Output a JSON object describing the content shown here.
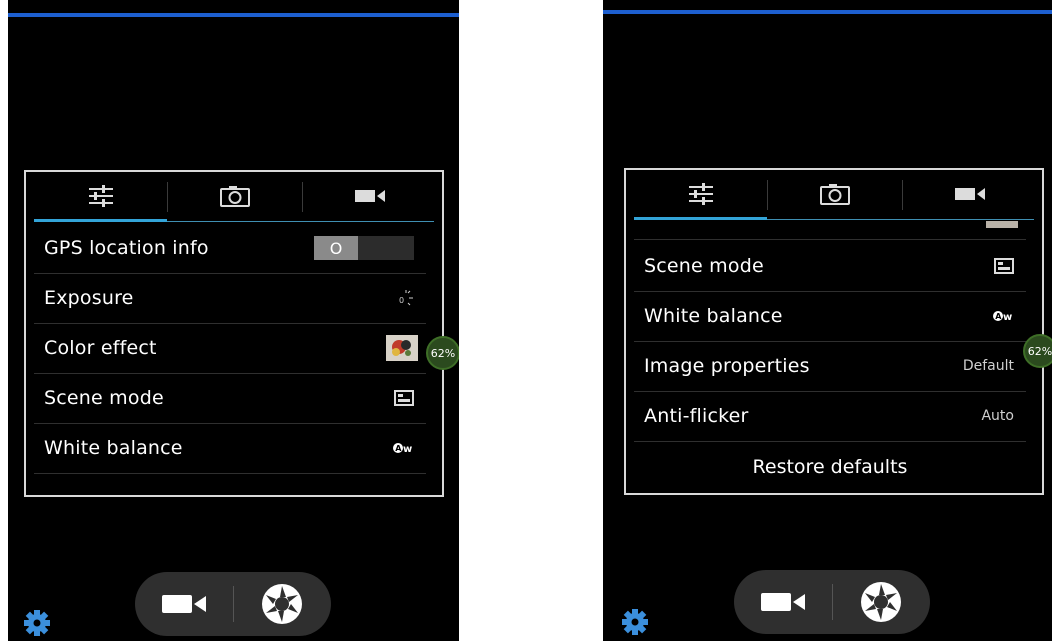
{
  "colors": {
    "accent": "#33a4d8",
    "topbar": "#1d5fd0",
    "gear": "#3b8fdc",
    "badge": "#2b4a1e"
  },
  "tabs": {
    "settings_icon": "sliders-icon",
    "camera_icon": "camera-icon",
    "video_icon": "video-camera-icon"
  },
  "left": {
    "gps": {
      "label": "GPS location info",
      "toggle_state": "O"
    },
    "exposure": {
      "label": "Exposure",
      "icon": "exposure-icon"
    },
    "color_effect": {
      "label": "Color effect",
      "icon": "color-effect-thumbnail"
    },
    "scene_mode": {
      "label": "Scene mode",
      "icon": "scene-mode-icon"
    },
    "white_balance": {
      "label": "White balance",
      "icon": "awb-icon"
    },
    "battery": "62%"
  },
  "right": {
    "scene_mode": {
      "label": "Scene mode",
      "icon": "scene-mode-icon"
    },
    "white_balance": {
      "label": "White balance",
      "icon": "awb-icon"
    },
    "image_properties": {
      "label": "Image properties",
      "value": "Default"
    },
    "anti_flicker": {
      "label": "Anti-flicker",
      "value": "Auto"
    },
    "restore": "Restore defaults",
    "battery": "62%"
  },
  "bottom": {
    "video_icon": "video-camera-icon",
    "shutter_icon": "shutter-icon",
    "settings_icon": "gear-icon"
  }
}
